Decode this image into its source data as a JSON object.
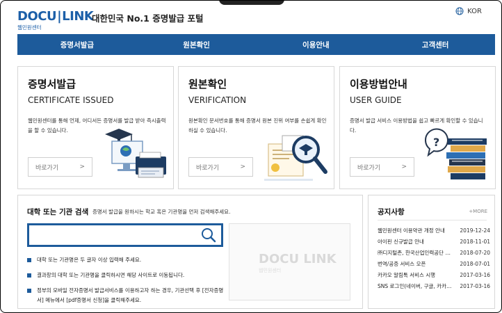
{
  "header": {
    "logo_text_left": "DOCU",
    "logo_text_right": "LINK",
    "logo_sub": "웹민원센터",
    "portal_title": "대한민국 No.1 증명발급 포털",
    "language": "KOR"
  },
  "nav": {
    "items": [
      {
        "label": "증명서발급"
      },
      {
        "label": "원본확인"
      },
      {
        "label": "이용안내"
      },
      {
        "label": "고객센터"
      }
    ]
  },
  "cards": [
    {
      "title": "증명서발급",
      "subtitle": "CERTIFICATE ISSUED",
      "desc": "웹민원센터를 통해 언제, 어디서든 증명서를 발급 받아 즉시출력을 할 수 있습니다.",
      "button": "바로가기",
      "button_arrow": ">"
    },
    {
      "title": "원본확인",
      "subtitle": "VERIFICATION",
      "desc": "원본확인 문서번호를 통해 증명서 원본 진위 여부를 손쉽게 확인하실 수 있습니다.",
      "button": "바로가기",
      "button_arrow": ">"
    },
    {
      "title": "이용방법안내",
      "subtitle": "USER GUIDE",
      "desc": "증명서 발급 서비스 이용방법을 쉽고 빠르게 확인할 수 있습니다.",
      "button": "바로가기",
      "button_arrow": ">"
    }
  ],
  "search": {
    "title": "대학 또는 기관 검색",
    "hint": "증명서 발급을 원하시는 학교 혹은 기관명을 먼저 검색해주세요.",
    "input_value": "",
    "input_placeholder": "",
    "notes": [
      "대학 또는 기관명은 두 글자 이상 입력해 주세요.",
      "결과창의 대학 또는 기관명을 클릭하시면 해당 사이트로 이동됩니다.",
      "정부의 모바일 전자증명서 발급서비스를 이용하고자 하는 경우, 기관선택 후 [전자증명서] 메뉴에서 [pdf증명서 신청]을 클릭해주세요."
    ],
    "preview_logo": "DOCU LINK",
    "preview_sub": "웹민원센터"
  },
  "notice": {
    "title": "공지사항",
    "more": "+MORE",
    "items": [
      {
        "title": "웹민원센터 이용약관 개정 안내",
        "date": "2019-12-24"
      },
      {
        "title": "아이핀 신규발급 안내",
        "date": "2018-11-01"
      },
      {
        "title": "㈜디지털존, 한국산업인력공단 업무협약",
        "date": "2018-07-20"
      },
      {
        "title": "번역/공증 서비스 오픈",
        "date": "2018-07-01"
      },
      {
        "title": "카카오 알림톡 서비스 시행",
        "date": "2017-03-16"
      },
      {
        "title": "SNS 로그인(네이버, 구글, 카카오) 서비스",
        "date": "2017-03-16"
      }
    ]
  },
  "colors": {
    "brand_blue": "#1d5b9b",
    "logo_blue": "#1c5fa8"
  }
}
